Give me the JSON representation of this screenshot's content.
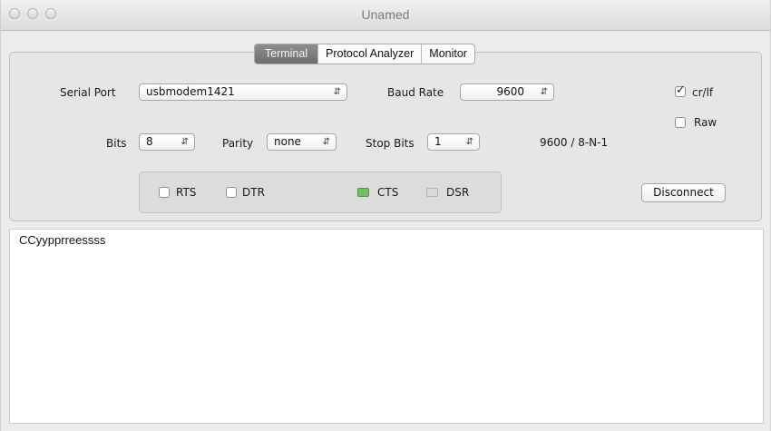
{
  "window": {
    "title": "Unamed"
  },
  "tabs": [
    {
      "label": "Terminal",
      "active": true
    },
    {
      "label": "Protocol Analyzer",
      "active": false
    },
    {
      "label": "Monitor",
      "active": false
    }
  ],
  "settings": {
    "serial_port_label": "Serial Port",
    "serial_port_value": "usbmodem1421",
    "baud_rate_label": "Baud Rate",
    "baud_rate_value": "9600",
    "bits_label": "Bits",
    "bits_value": "8",
    "parity_label": "Parity",
    "parity_value": "none",
    "stop_bits_label": "Stop Bits",
    "stop_bits_value": "1",
    "summary": "9600 / 8-N-1",
    "crlf_label": "cr/lf",
    "crlf_checked": true,
    "raw_label": "Raw",
    "raw_checked": false
  },
  "signals": [
    {
      "label": "RTS",
      "kind": "checkbox",
      "state": false
    },
    {
      "label": "DTR",
      "kind": "checkbox",
      "state": false
    },
    {
      "label": "CTS",
      "kind": "indicator",
      "state": true,
      "color": "#6ec25a"
    },
    {
      "label": "DSR",
      "kind": "indicator",
      "state": false,
      "color": "#d9d9d9"
    }
  ],
  "disconnect_label": "Disconnect",
  "terminal": {
    "text": "CCyypprreessss"
  },
  "icons": {
    "popup_arrows": "up-down-arrows-icon",
    "checkmark": "checkmark-icon"
  },
  "colors": {
    "active_tab": "#7d7d7d",
    "cts_on": "#6ec25a",
    "window_bg": "#ececec"
  }
}
